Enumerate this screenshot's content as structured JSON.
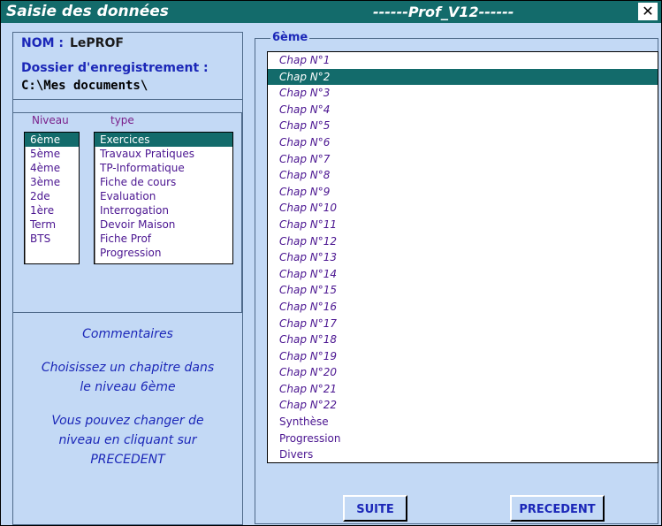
{
  "window": {
    "title": "Saisie des données",
    "subtitle": "------Prof_V12------",
    "close_glyph": "✕"
  },
  "info": {
    "nom_label": "NOM : ",
    "nom_value": "LePROF",
    "dossier_label": "Dossier d'enregistrement :",
    "dossier_value": "C:\\Mes documents\\"
  },
  "niveau": {
    "header": "Niveau",
    "items": [
      "6ème",
      "5ème",
      "4ème",
      "3ème",
      "2de",
      "1ère",
      "Term",
      "BTS"
    ],
    "selected": "6ème"
  },
  "type": {
    "header": "type",
    "items": [
      "Exercices",
      "Travaux Pratiques",
      "TP-Informatique",
      "Fiche de cours",
      "Evaluation",
      "Interrogation",
      "Devoir Maison",
      "Fiche Prof",
      "Progression"
    ],
    "selected": "Exercices"
  },
  "comments": {
    "title": "Commentaires",
    "line1": "Choisissez un chapitre dans",
    "line2": "le niveau 6ème",
    "line3": "Vous pouvez changer de",
    "line4": "niveau en cliquant sur",
    "line5": "PRECEDENT"
  },
  "chapters": {
    "group_label": "6ème",
    "items": [
      "Chap N°1",
      "Chap N°2",
      "Chap N°3",
      "Chap N°4",
      "Chap N°5",
      "Chap N°6",
      "Chap N°7",
      "Chap N°8",
      "Chap N°9",
      "Chap N°10",
      "Chap N°11",
      "Chap N°12",
      "Chap N°13",
      "Chap N°14",
      "Chap N°15",
      "Chap N°16",
      "Chap N°17",
      "Chap N°18",
      "Chap N°19",
      "Chap N°20",
      "Chap N°21",
      "Chap N°22",
      "Synthèse",
      "Progression",
      "Divers"
    ],
    "selected": "Chap N°2"
  },
  "buttons": {
    "suite": "SUITE",
    "precedent": "PRECEDENT"
  },
  "colors": {
    "title_bar": "#136b6b",
    "background": "#c3d9f5",
    "selection": "#136b6b",
    "label_blue": "#1b27b8",
    "item_purple": "#4a1490"
  }
}
